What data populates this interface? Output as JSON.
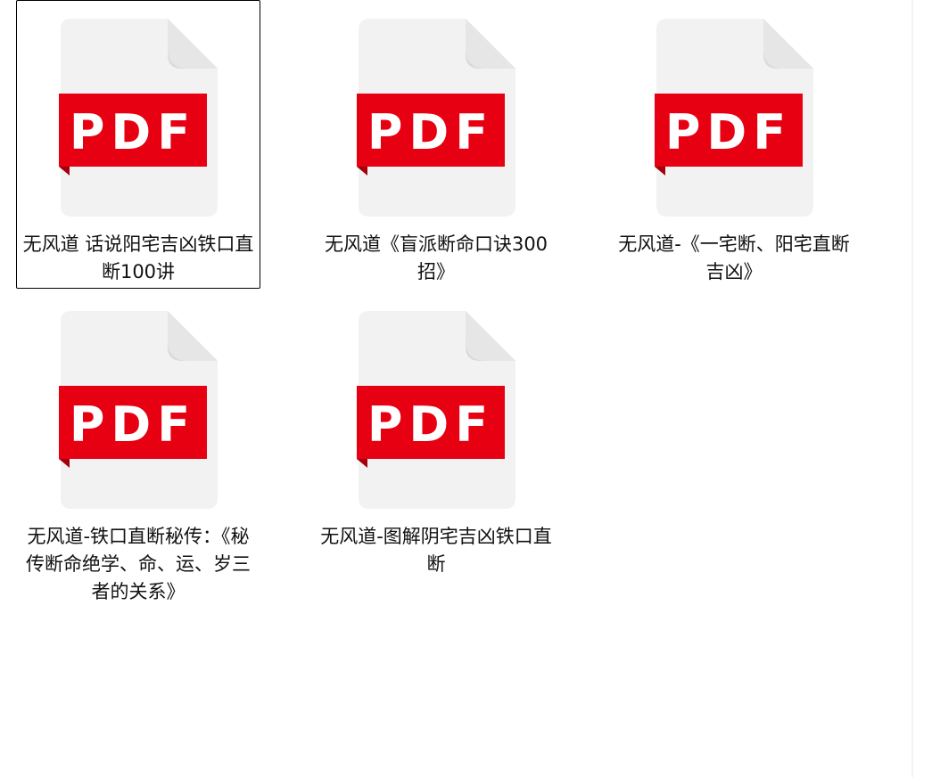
{
  "files": [
    {
      "name": "无风道 话说阳宅吉凶铁口直断100讲",
      "type_label": "PDF",
      "selected": true
    },
    {
      "name": "无风道《盲派断命口诀300招》",
      "type_label": "PDF",
      "selected": false
    },
    {
      "name": "无风道-《一宅断、阳宅直断吉凶》",
      "type_label": "PDF",
      "selected": false
    },
    {
      "name": "无风道-铁口直断秘传：《秘传断命绝学、命、运、岁三者的关系》",
      "type_label": "PDF",
      "selected": false
    },
    {
      "name": "无风道-图解阴宅吉凶铁口直断",
      "type_label": "PDF",
      "selected": false
    }
  ],
  "colors": {
    "badge_red": "#e60012",
    "badge_shadow": "#a3000d",
    "page_fill": "#f2f2f2",
    "fold_fill": "#d9d9d9"
  },
  "icons": {
    "file": "pdf-file-icon"
  }
}
